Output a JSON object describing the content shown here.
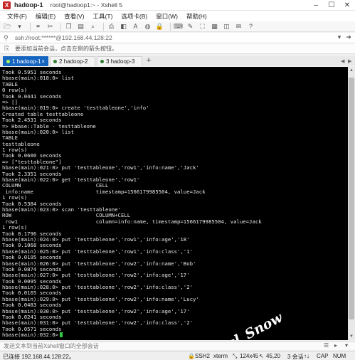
{
  "window": {
    "tab_title": "hadoop-1",
    "subtitle": "root@hadoop1:~ - Xshell 5",
    "min_icon": "minimize-icon",
    "max_icon": "maximize-icon",
    "close_icon": "close-icon"
  },
  "menu": [
    "文件(F)",
    "编辑(E)",
    "查看(V)",
    "工具(T)",
    "选项卡(B)",
    "窗口(W)",
    "帮助(H)"
  ],
  "address": {
    "value": "ssh://root:******@192.168.44.128:22"
  },
  "infobar": {
    "text": "要添加当前会话，点击左侧的箭头按钮。"
  },
  "tabs": [
    {
      "label": "1 hadoop-1",
      "active": true
    },
    {
      "label": "2 hadoop-2",
      "active": false
    },
    {
      "label": "3 hadoop-3",
      "active": false
    }
  ],
  "terminal": {
    "lines": [
      "Took 0.5951 seconds",
      "hbase(main):018:0> list",
      "TABLE",
      "0 row(s)",
      "Took 0.0441 seconds",
      "=> []",
      "hbase(main):019:0> create 'testtableone','info'",
      "Created table testtableone",
      "Took 2.4531 seconds",
      "=> Hbase::Table - testtableone",
      "hbase(main):020:0> list",
      "TABLE",
      "testtableone",
      "1 row(s)",
      "Took 0.0600 seconds",
      "=> [\"testtableone\"]",
      "hbase(main):021:0> put 'testtableone','row1','info:name','Jack'",
      "Took 2.3351 seconds",
      "hbase(main):022:0> get 'testtableone','row1'",
      "COLUMN                        CELL",
      " info:name                    timestamp=1566179985504, value=Jack",
      "1 row(s)",
      "Took 0.5384 seconds",
      "hbase(main):023:0> scan 'testtableone'",
      "ROW                           COLUMN+CELL",
      " row1                         column=info:name, timestamp=1566179985504, value=Jack",
      "1 row(s)",
      "Took 0.1796 seconds",
      "hbase(main):024:0> put 'testtableone','row1','info:age','18'",
      "Took 0.1068 seconds",
      "hbase(main):025:0> put 'testtableone','row1','info:class','1'",
      "Took 0.0195 seconds",
      "hbase(main):026:0> put 'testtableone','row2','info:name','Bob'",
      "Took 0.0874 seconds",
      "hbase(main):027:0> put 'testtableone','row2','info:age','17'",
      "Took 0.0095 seconds",
      "hbase(main):028:0> put 'testtableone','row2','info:class','2'",
      "Took 0.0165 seconds",
      "hbase(main):029:0> put 'testtableone','row2','info:name','Lucy'",
      "Took 0.0483 seconds",
      "hbase(main):030:0> put 'testtableone','row2','info:age','17'",
      "Took 0.0241 seconds",
      "hbase(main):031:0> put 'testtableone','row2','info:class','2'",
      "Took 0.0571 seconds",
      "hbase(main):032:0>"
    ],
    "watermark": "Dcl_Snow",
    "background": "#000000",
    "foreground": "#e6e6e6",
    "cursor_color": "#2ecc40"
  },
  "compose": {
    "placeholder": "发送文本到当前Xshell窗口的全部会话"
  },
  "status": {
    "connection": "已连接 192.168.44.128:22。",
    "protocol": "SSH2",
    "terminal_type": "xterm",
    "size": "124x45",
    "cursor_pos": "45,20",
    "sessions": "3 会话",
    "cap": "CAP",
    "num": "NUM"
  },
  "colors": {
    "active_tab": "#1565c0",
    "app_icon": "#c62828"
  }
}
